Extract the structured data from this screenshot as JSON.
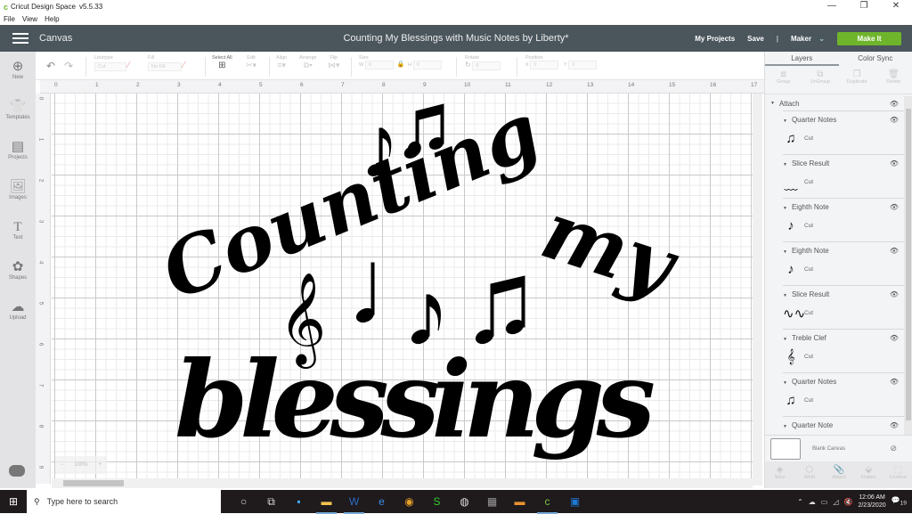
{
  "window": {
    "app_name": "Cricut Design Space",
    "version": "v5.5.33",
    "controls": {
      "minimize": "—",
      "restore": "❐",
      "close": "✕"
    }
  },
  "menubar": [
    "File",
    "View",
    "Help"
  ],
  "header": {
    "section": "Canvas",
    "project_title": "Counting My Blessings with Music Notes by Liberty*",
    "my_projects": "My Projects",
    "save": "Save",
    "divider": "|",
    "machine": "Maker",
    "make_it": "Make It"
  },
  "toolbar": {
    "linetype_label": "Linetype",
    "linetype_value": "Cut",
    "fill_label": "Fill",
    "fill_value": "No Fill",
    "select_all": "Select All",
    "edit": "Edit",
    "align": "Align",
    "arrange": "Arrange",
    "flip": "Flip",
    "size_label": "Size",
    "w_label": "W",
    "w_value": "0",
    "h_label": "H",
    "h_value": "0",
    "rotate_label": "Rotate",
    "rotate_value": "0",
    "position_label": "Position",
    "x_label": "X",
    "x_value": "0",
    "y_label": "Y",
    "y_value": "0"
  },
  "sidebar": {
    "items": [
      {
        "label": "New",
        "icon": "plus-circle-icon",
        "glyph": "⊕"
      },
      {
        "label": "Templates",
        "icon": "tshirt-icon",
        "glyph": "👕"
      },
      {
        "label": "Projects",
        "icon": "notebook-icon",
        "glyph": "▤"
      },
      {
        "label": "Images",
        "icon": "image-icon",
        "glyph": "🖼"
      },
      {
        "label": "Text",
        "icon": "text-icon",
        "glyph": "T"
      },
      {
        "label": "Shapes",
        "icon": "shapes-icon",
        "glyph": "✿"
      },
      {
        "label": "Upload",
        "icon": "cloud-upload-icon",
        "glyph": "☁"
      }
    ]
  },
  "rulers": {
    "top": [
      "0",
      "1",
      "2",
      "3",
      "4",
      "5",
      "6",
      "7",
      "8",
      "9",
      "10",
      "11",
      "12",
      "13",
      "14",
      "15",
      "16",
      "17"
    ],
    "left": [
      "0",
      "1",
      "2",
      "3",
      "4",
      "5",
      "6",
      "7",
      "8",
      "9"
    ]
  },
  "canvas": {
    "zoom": "100%",
    "zoom_out": "−",
    "zoom_in": "+",
    "art_lines": [
      "Counting",
      "my",
      "blessings"
    ]
  },
  "panel": {
    "tabs": [
      "Layers",
      "Color Sync"
    ],
    "active_tab": "Layers",
    "tools": [
      "Group",
      "UnGroup",
      "Duplicate",
      "Delete"
    ],
    "group_name": "Attach",
    "layers": [
      {
        "name": "Quarter Notes",
        "operation": "Cut",
        "thumb": "♫"
      },
      {
        "name": "Slice Result",
        "operation": "Cut",
        "thumb": "﹏"
      },
      {
        "name": "Eighth Note",
        "operation": "Cut",
        "thumb": "♪"
      },
      {
        "name": "Eighth Note",
        "operation": "Cut",
        "thumb": "♪"
      },
      {
        "name": "Slice Result",
        "operation": "Cut",
        "thumb": "∿∿"
      },
      {
        "name": "Treble Clef",
        "operation": "Cut",
        "thumb": "𝄞"
      },
      {
        "name": "Quarter Notes",
        "operation": "Cut",
        "thumb": "♫"
      },
      {
        "name": "Quarter Note",
        "operation": "Cut",
        "thumb": "♩"
      }
    ],
    "blank_canvas": "Blank Canvas",
    "bottom_tools": [
      "Slice",
      "Weld",
      "Attach",
      "Flatten",
      "Contour"
    ]
  },
  "taskbar": {
    "search_placeholder": "Type here to search",
    "time": "12:06 AM",
    "date": "2/23/2020",
    "notifications": "19"
  }
}
